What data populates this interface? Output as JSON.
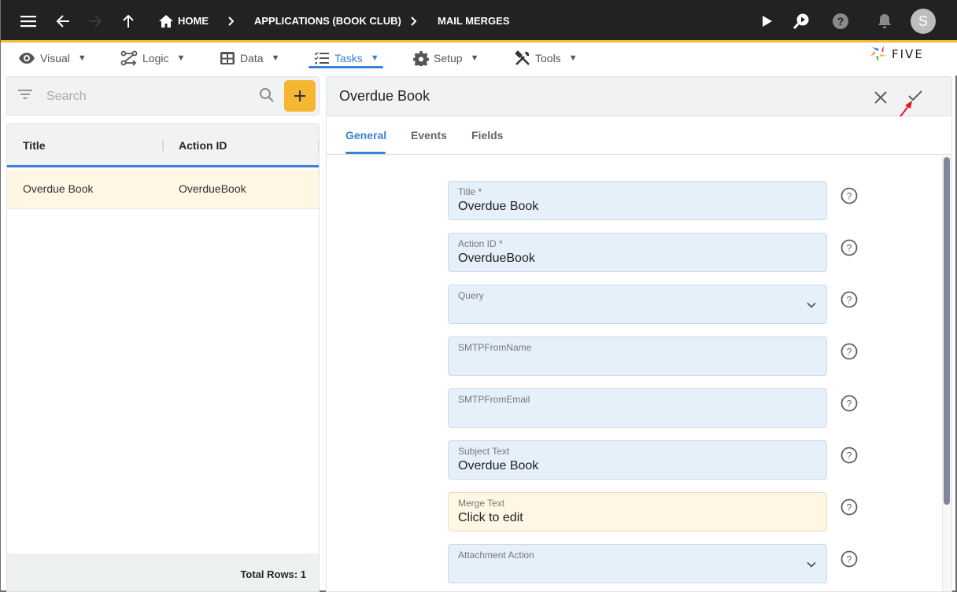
{
  "topbar": {
    "breadcrumbs": [
      "HOME",
      "APPLICATIONS (BOOK CLUB)",
      "MAIL MERGES"
    ],
    "avatar_initial": "S",
    "icons": [
      "menu-icon",
      "back-arrow-icon",
      "forward-arrow-icon",
      "up-arrow-icon",
      "home-icon",
      "play-icon",
      "search-play-icon",
      "help-icon",
      "bell-icon"
    ]
  },
  "menu": {
    "items": [
      {
        "label": "Visual",
        "icon": "eye-icon",
        "caret": "▼"
      },
      {
        "label": "Logic",
        "icon": "flow-icon",
        "caret": "▼"
      },
      {
        "label": "Data",
        "icon": "table-icon",
        "caret": "▼"
      },
      {
        "label": "Tasks",
        "icon": "checklist-icon",
        "caret": "▼",
        "active": true
      },
      {
        "label": "Setup",
        "icon": "gear-icon",
        "caret": "▼"
      },
      {
        "label": "Tools",
        "icon": "tools-icon",
        "caret": "▼"
      }
    ],
    "logo_text": "FIVE"
  },
  "list": {
    "search_placeholder": "Search",
    "add_label": "+",
    "columns": [
      "Title",
      "Action ID"
    ],
    "rows": [
      {
        "title": "Overdue Book",
        "action_id": "OverdueBook"
      }
    ],
    "footer": "Total Rows: 1"
  },
  "form": {
    "title": "Overdue Book",
    "tabs": [
      {
        "label": "General",
        "active": true
      },
      {
        "label": "Events"
      },
      {
        "label": "Fields"
      }
    ],
    "fields": [
      {
        "label": "Title *",
        "value": "Overdue Book",
        "type": "text"
      },
      {
        "label": "Action ID *",
        "value": "OverdueBook",
        "type": "text"
      },
      {
        "label": "Query",
        "value": "",
        "type": "select"
      },
      {
        "label": "SMTPFromName",
        "value": "",
        "type": "text"
      },
      {
        "label": "SMTPFromEmail",
        "value": "",
        "type": "text"
      },
      {
        "label": "Subject Text",
        "value": "Overdue Book",
        "type": "text"
      },
      {
        "label": "Merge Text",
        "value": "Click to edit",
        "type": "editor"
      },
      {
        "label": "Attachment Action",
        "value": "",
        "type": "select"
      }
    ]
  },
  "colors": {
    "accent": "#3b82d6",
    "brand_yellow": "#f5b731",
    "topbar_bg": "#222222",
    "field_bg": "#e5f0fb",
    "selected_row_bg": "#fff6e3"
  }
}
